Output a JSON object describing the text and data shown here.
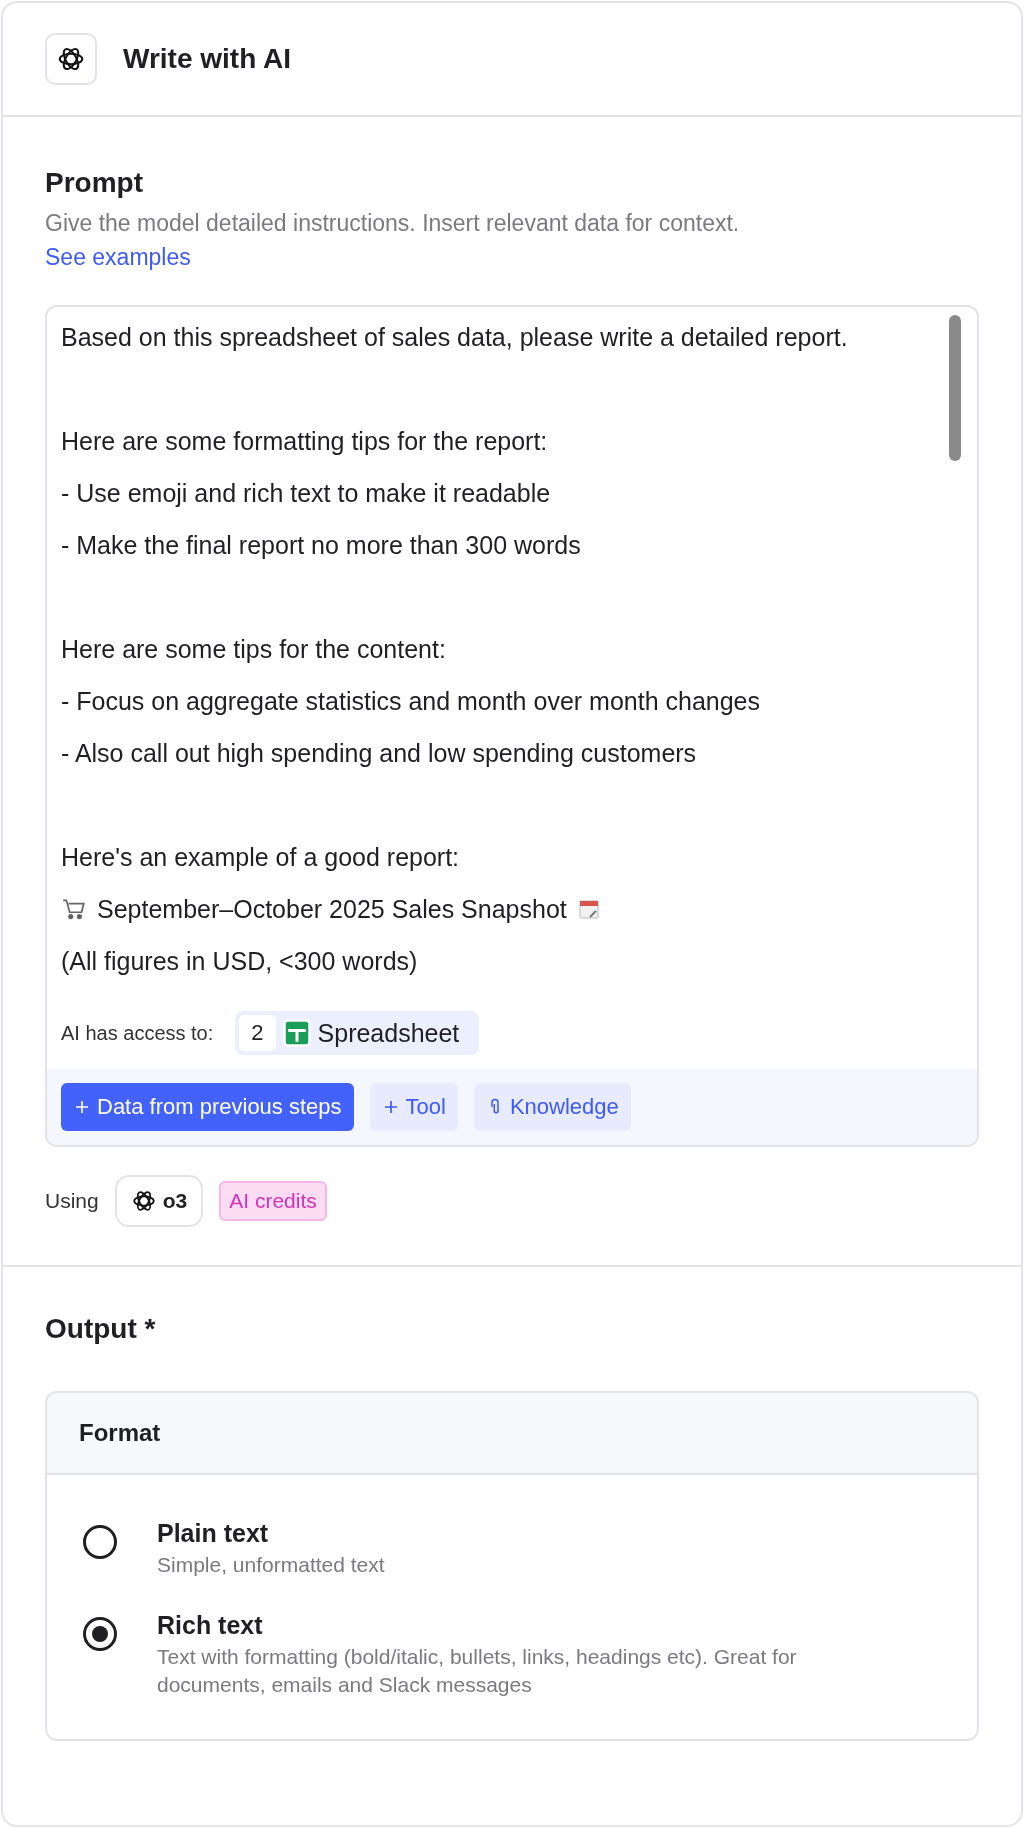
{
  "header": {
    "title": "Write with AI"
  },
  "prompt": {
    "heading": "Prompt",
    "description": "Give the model detailed instructions. Insert relevant data for context.",
    "link": "See examples",
    "paragraphs": [
      [
        {
          "kind": "text",
          "text": "Based on this spreadsheet of sales data, please write a detailed report."
        }
      ],
      [
        {
          "kind": "text",
          "text": "Here are some formatting tips for the report:"
        },
        {
          "kind": "text",
          "text": "- Use emoji and rich text to make it readable"
        },
        {
          "kind": "text",
          "text": "- Make the final report no more than 300 words"
        }
      ],
      [
        {
          "kind": "text",
          "text": "Here are some tips for the content:"
        },
        {
          "kind": "text",
          "text": "- Focus on aggregate statistics and month over month changes"
        },
        {
          "kind": "text",
          "text": "- Also call out high spending and low spending customers"
        }
      ],
      [
        {
          "kind": "text",
          "text": "Here's an example of a good report:"
        },
        {
          "kind": "heading",
          "text": "September–October 2025 Sales Snapshot"
        },
        {
          "kind": "text",
          "text": "(All figures in USD, <300 words)"
        }
      ]
    ],
    "access_label": "AI has access to:",
    "access_step": "2",
    "access_app": "Spreadsheet",
    "buttons": [
      {
        "kind": "primary",
        "label": "Data from previous steps"
      },
      {
        "kind": "tool",
        "label": "Tool"
      },
      {
        "kind": "knowledge",
        "label": "Knowledge"
      }
    ]
  },
  "model": {
    "label": "Using",
    "name": "o3",
    "badge": "AI credits"
  },
  "output": {
    "heading": "Output *",
    "format_title": "Format",
    "options": [
      {
        "title": "Plain text",
        "description": "Simple, unformatted text",
        "selected": false
      },
      {
        "title": "Rich text",
        "description": "Text with formatting (bold/italic, bullets, links, headings etc). Great for documents, emails and Slack messages",
        "selected": true
      }
    ]
  }
}
